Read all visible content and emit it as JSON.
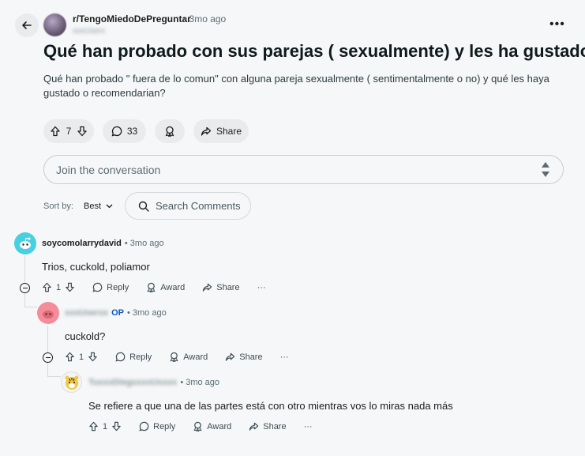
{
  "post": {
    "subreddit": "r/TengoMiedoDePreguntar",
    "time": "• 3mo ago",
    "author": "xxxUserx",
    "title": "Qué han probado con sus parejas ( sexualmente) y les ha gustado ?",
    "body": "Qué han probado \" fuera de lo comun\" con alguna pareja sexualmente ( sentimentalmente o no) y qué les haya gustado o recomendarian?",
    "votes": "7",
    "comments": "33",
    "share_label": "Share"
  },
  "composer": {
    "placeholder": "Join the conversation"
  },
  "sort": {
    "label": "Sort by:",
    "value": "Best"
  },
  "search": {
    "label": "Search Comments"
  },
  "comments": [
    {
      "author": "soycomolarrydavid",
      "time": "• 3mo ago",
      "text": "Trios, cuckold, poliamor",
      "votes": "1",
      "reply": "Reply",
      "award": "Award",
      "share": "Share",
      "more": "···"
    },
    {
      "author": "xxxUserxx",
      "op": "OP",
      "time": "• 3mo ago",
      "text": "cuckold?",
      "votes": "1",
      "reply": "Reply",
      "award": "Award",
      "share": "Share",
      "more": "···"
    },
    {
      "author": "TuxxxDiegoxxxUsxxx",
      "time": "• 3mo ago",
      "text": "Se refiere a que una de las partes está con otro mientras vos lo miras nada más",
      "votes": "1",
      "reply": "Reply",
      "award": "Award",
      "share": "Share",
      "more": "···"
    }
  ],
  "icons": {
    "back": "arrow-left-icon",
    "upvote": "arrow-up-icon",
    "downvote": "arrow-down-icon",
    "comment": "speech-bubble-icon",
    "award": "award-icon",
    "share": "share-arrow-icon",
    "search": "search-icon",
    "more": "more-dots-icon"
  },
  "colors": {
    "background": "#f6f7f8",
    "pill": "#e9ebec",
    "op": "#0a56c2"
  }
}
